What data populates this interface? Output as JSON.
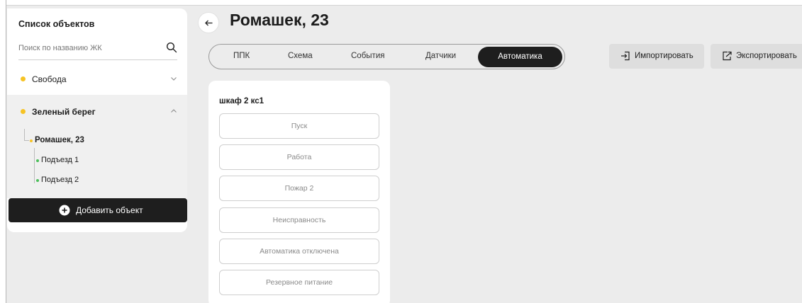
{
  "sidebar": {
    "title": "Список объектов",
    "search": {
      "placeholder": "Поиск по названию ЖК",
      "value": ""
    },
    "groups": [
      {
        "label": "Свобода",
        "expanded": false
      },
      {
        "label": "Зеленый берег",
        "expanded": true,
        "objects": [
          {
            "label": "Ромашек, 23",
            "entrances": [
              "Подъезд 1",
              "Подъезд 2"
            ]
          }
        ]
      }
    ],
    "add_button": "Добавить объект"
  },
  "header": {
    "title": "Ромашек, 23"
  },
  "tabs": [
    {
      "label": "ППК",
      "active": false
    },
    {
      "label": "Схема",
      "active": false
    },
    {
      "label": "События",
      "active": false
    },
    {
      "label": "Датчики",
      "active": false
    },
    {
      "label": "Автоматика",
      "active": true
    }
  ],
  "actions": {
    "import": "Импортировать",
    "export": "Экспортировать"
  },
  "panel": {
    "title": "шкаф 2 кс1",
    "states": [
      "Пуск",
      "Работа",
      "Пожар 2",
      "Неисправность",
      "Автоматика отключена",
      "Резервное питание"
    ]
  },
  "colors": {
    "accent_dark": "#1e1e1e",
    "group_dot": "#f6c324",
    "entrance_dot": "#4bbf5a",
    "background": "#ececec"
  },
  "icons": [
    "search-icon",
    "chevron-down-icon",
    "chevron-up-icon",
    "plus-circle-icon",
    "arrow-left-icon",
    "import-icon",
    "export-icon"
  ]
}
